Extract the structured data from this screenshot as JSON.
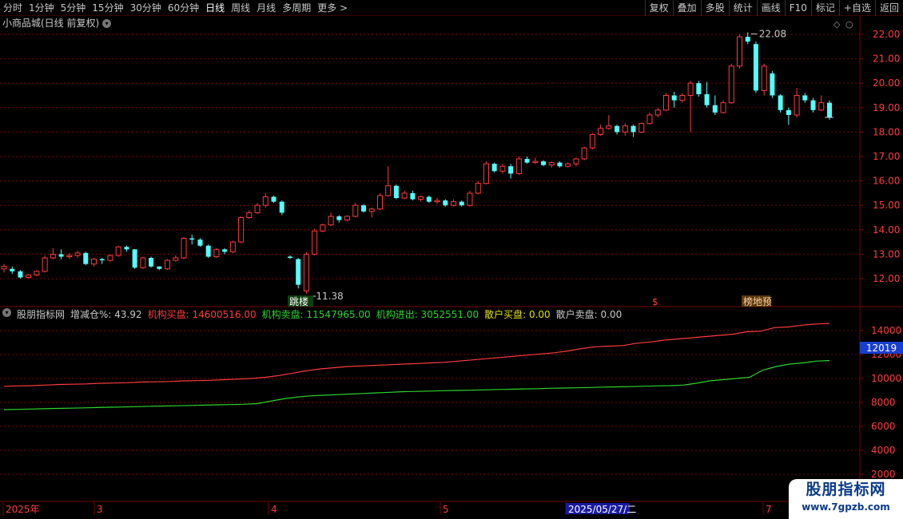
{
  "toolbar": {
    "periods": [
      "分时",
      "1分钟",
      "5分钟",
      "15分钟",
      "30分钟",
      "60分钟",
      "日线",
      "周线",
      "月线",
      "多周期",
      "更多"
    ],
    "active_period": "日线",
    "tools": [
      "复权",
      "叠加",
      "多股",
      "统计",
      "画线",
      "F10",
      "标记",
      "+自选",
      "返回"
    ]
  },
  "chart_title": "小商品城(日线 前复权)",
  "price_axis": [
    "22.00",
    "21.00",
    "20.00",
    "19.00",
    "18.00",
    "17.00",
    "16.00",
    "15.00",
    "14.00",
    "13.00",
    "12.00"
  ],
  "indicator_axis": [
    "14000",
    "12000",
    "10000",
    "8000",
    "6000",
    "4000",
    "2000"
  ],
  "indicator_current": "12019",
  "annotations": {
    "high": "22.08",
    "low": "11.38"
  },
  "signals": {
    "low_signal": "跳楼",
    "mid_signal": "$",
    "high_signal": "榜地预"
  },
  "indicator": {
    "name": "股朋指标网",
    "items": [
      {
        "label": "增减仓%: 43.92",
        "color": "#c8c8c8"
      },
      {
        "label": "机构买盘: 14600516.00",
        "color": "#ff3b3b"
      },
      {
        "label": "机构卖盘: 11547965.00",
        "color": "#2bd52b"
      },
      {
        "label": "机构进出: 3052551.00",
        "color": "#2bd52b"
      },
      {
        "label": "散户买盘: 0.00",
        "color": "#e0e000"
      },
      {
        "label": "散户卖盘: 0.00",
        "color": "#c8c8c8"
      }
    ]
  },
  "date_axis": [
    "2025年",
    "3",
    "4",
    "5",
    "2025/05/27/二",
    "7"
  ],
  "watermark": {
    "line1": "股朋指标网",
    "line2": "www.7gpzb.com"
  },
  "colors": {
    "up": "#ff3b3b",
    "down": "#54ffff",
    "grid": "#7a0000",
    "buy_line": "#ff3b3b",
    "sell_line": "#2bd52b"
  },
  "chart_data": {
    "type": "candlestick",
    "price_range": [
      11.0,
      22.4
    ],
    "candles": [
      [
        12.5,
        12.4,
        12.6,
        12.25,
        "u"
      ],
      [
        12.4,
        12.3,
        12.5,
        12.2,
        "d"
      ],
      [
        12.3,
        12.05,
        12.35,
        12.0,
        "d"
      ],
      [
        12.05,
        12.15,
        12.2,
        12.0,
        "u"
      ],
      [
        12.15,
        12.3,
        12.35,
        12.1,
        "u"
      ],
      [
        12.3,
        12.85,
        12.95,
        12.25,
        "u"
      ],
      [
        12.85,
        13.0,
        13.25,
        12.8,
        "u"
      ],
      [
        13.0,
        12.9,
        13.2,
        12.8,
        "d"
      ],
      [
        12.9,
        12.95,
        13.05,
        12.8,
        "u"
      ],
      [
        12.95,
        13.05,
        13.15,
        12.85,
        "u"
      ],
      [
        13.05,
        12.6,
        13.1,
        12.55,
        "d"
      ],
      [
        12.6,
        12.8,
        12.85,
        12.5,
        "u"
      ],
      [
        12.8,
        12.75,
        12.85,
        12.6,
        "d"
      ],
      [
        12.75,
        12.95,
        13.0,
        12.7,
        "u"
      ],
      [
        12.95,
        13.3,
        13.35,
        12.9,
        "u"
      ],
      [
        13.3,
        13.2,
        13.35,
        13.1,
        "d"
      ],
      [
        13.2,
        12.45,
        13.2,
        12.4,
        "d"
      ],
      [
        12.45,
        12.85,
        12.9,
        12.4,
        "u"
      ],
      [
        12.85,
        12.5,
        12.9,
        12.45,
        "d"
      ],
      [
        12.5,
        12.4,
        12.5,
        12.35,
        "d"
      ],
      [
        12.4,
        12.75,
        12.8,
        12.35,
        "u"
      ],
      [
        12.75,
        12.85,
        12.95,
        12.7,
        "u"
      ],
      [
        12.85,
        13.65,
        13.7,
        12.8,
        "u"
      ],
      [
        13.65,
        13.6,
        13.8,
        13.4,
        "d"
      ],
      [
        13.6,
        13.35,
        13.65,
        13.3,
        "d"
      ],
      [
        13.35,
        12.9,
        13.4,
        12.85,
        "d"
      ],
      [
        12.9,
        13.2,
        13.25,
        12.85,
        "u"
      ],
      [
        13.2,
        13.1,
        13.25,
        13.0,
        "d"
      ],
      [
        13.1,
        13.5,
        13.55,
        13.05,
        "u"
      ],
      [
        13.5,
        14.5,
        14.55,
        13.45,
        "u"
      ],
      [
        14.5,
        14.7,
        14.8,
        14.45,
        "u"
      ],
      [
        14.7,
        15.0,
        15.1,
        14.65,
        "u"
      ],
      [
        15.0,
        15.35,
        15.5,
        14.9,
        "u"
      ],
      [
        15.35,
        15.15,
        15.4,
        15.1,
        "d"
      ],
      [
        15.15,
        14.7,
        15.2,
        14.6,
        "d"
      ],
      [
        12.9,
        12.85,
        12.95,
        12.8,
        "d"
      ],
      [
        12.8,
        11.75,
        12.85,
        11.6,
        "d"
      ],
      [
        11.5,
        13.0,
        13.1,
        11.38,
        "u"
      ],
      [
        13.0,
        13.95,
        14.05,
        12.95,
        "u"
      ],
      [
        13.95,
        14.2,
        14.25,
        13.9,
        "u"
      ],
      [
        14.2,
        14.55,
        14.7,
        14.15,
        "u"
      ],
      [
        14.55,
        14.4,
        14.6,
        14.3,
        "d"
      ],
      [
        14.4,
        14.55,
        14.6,
        14.35,
        "u"
      ],
      [
        14.55,
        15.0,
        15.1,
        14.5,
        "u"
      ],
      [
        15.0,
        14.75,
        15.05,
        14.7,
        "d"
      ],
      [
        14.75,
        14.85,
        14.9,
        14.5,
        "u"
      ],
      [
        14.85,
        15.4,
        15.5,
        14.8,
        "u"
      ],
      [
        15.4,
        15.8,
        16.6,
        15.35,
        "u"
      ],
      [
        15.8,
        15.3,
        15.85,
        15.25,
        "d"
      ],
      [
        15.3,
        15.5,
        15.6,
        15.25,
        "u"
      ],
      [
        15.5,
        15.25,
        15.6,
        15.2,
        "d"
      ],
      [
        15.25,
        15.35,
        15.4,
        15.15,
        "u"
      ],
      [
        15.35,
        15.15,
        15.4,
        15.1,
        "d"
      ],
      [
        15.15,
        15.2,
        15.3,
        15.05,
        "u"
      ],
      [
        15.2,
        15.0,
        15.25,
        14.95,
        "d"
      ],
      [
        15.0,
        15.15,
        15.25,
        14.95,
        "u"
      ],
      [
        15.15,
        15.0,
        15.2,
        14.95,
        "d"
      ],
      [
        15.0,
        15.5,
        15.6,
        14.95,
        "u"
      ],
      [
        15.5,
        15.9,
        16.0,
        15.45,
        "u"
      ],
      [
        15.9,
        16.7,
        16.8,
        15.85,
        "u"
      ],
      [
        16.7,
        16.4,
        16.75,
        16.35,
        "d"
      ],
      [
        16.4,
        16.6,
        16.7,
        16.3,
        "u"
      ],
      [
        16.6,
        16.3,
        16.7,
        16.1,
        "d"
      ],
      [
        16.3,
        16.9,
        17.0,
        16.25,
        "u"
      ],
      [
        16.9,
        16.75,
        17.0,
        16.7,
        "d"
      ],
      [
        16.75,
        16.8,
        16.95,
        16.7,
        "u"
      ],
      [
        16.8,
        16.65,
        16.85,
        16.6,
        "d"
      ],
      [
        16.65,
        16.75,
        16.8,
        16.55,
        "u"
      ],
      [
        16.75,
        16.6,
        16.8,
        16.55,
        "d"
      ],
      [
        16.6,
        16.7,
        16.75,
        16.55,
        "u"
      ],
      [
        16.7,
        16.9,
        16.95,
        16.6,
        "u"
      ],
      [
        16.9,
        17.35,
        17.4,
        16.85,
        "u"
      ],
      [
        17.35,
        17.9,
        17.95,
        17.3,
        "u"
      ],
      [
        17.9,
        18.15,
        18.3,
        17.85,
        "u"
      ],
      [
        18.15,
        18.25,
        18.7,
        18.1,
        "u"
      ],
      [
        18.25,
        18.0,
        18.3,
        17.9,
        "d"
      ],
      [
        18.0,
        18.25,
        18.35,
        17.85,
        "u"
      ],
      [
        18.25,
        18.0,
        18.3,
        17.8,
        "d"
      ],
      [
        18.0,
        18.35,
        18.4,
        17.95,
        "u"
      ],
      [
        18.35,
        18.7,
        18.8,
        18.3,
        "u"
      ],
      [
        18.7,
        18.9,
        19.0,
        18.6,
        "u"
      ],
      [
        18.9,
        19.5,
        19.6,
        18.85,
        "u"
      ],
      [
        19.5,
        19.3,
        19.65,
        19.0,
        "d"
      ],
      [
        19.3,
        19.5,
        19.6,
        19.2,
        "u"
      ],
      [
        19.5,
        20.0,
        20.1,
        18.0,
        "u"
      ],
      [
        20.0,
        19.55,
        20.1,
        19.45,
        "d"
      ],
      [
        19.55,
        19.1,
        20.05,
        19.0,
        "d"
      ],
      [
        19.1,
        18.8,
        19.5,
        18.7,
        "d"
      ],
      [
        18.8,
        19.2,
        19.3,
        18.75,
        "u"
      ],
      [
        19.2,
        20.7,
        20.8,
        19.15,
        "u"
      ],
      [
        20.7,
        21.9,
        22.0,
        20.6,
        "u"
      ],
      [
        21.9,
        21.7,
        22.08,
        21.6,
        "d"
      ],
      [
        21.6,
        19.7,
        21.7,
        19.6,
        "d"
      ],
      [
        19.7,
        20.7,
        20.8,
        19.5,
        "u"
      ],
      [
        20.4,
        19.5,
        20.5,
        19.4,
        "d"
      ],
      [
        19.5,
        18.9,
        19.55,
        18.8,
        "d"
      ],
      [
        18.9,
        18.7,
        19.0,
        18.3,
        "d"
      ],
      [
        18.7,
        19.5,
        19.8,
        18.6,
        "u"
      ],
      [
        19.5,
        19.3,
        19.6,
        19.2,
        "d"
      ],
      [
        19.3,
        18.9,
        19.4,
        18.8,
        "d"
      ],
      [
        18.9,
        19.2,
        19.5,
        18.85,
        "u"
      ],
      [
        19.2,
        18.6,
        19.3,
        18.5,
        "d"
      ]
    ],
    "indicator_range": [
      2000,
      15000
    ],
    "buy_line": [
      9350,
      9380,
      9400,
      9450,
      9500,
      9520,
      9550,
      9600,
      9620,
      9650,
      9700,
      9720,
      9750,
      9800,
      9820,
      9850,
      9900,
      9950,
      10000,
      10100,
      10250,
      10450,
      10650,
      10800,
      10900,
      11000,
      11050,
      11100,
      11150,
      11200,
      11250,
      11300,
      11350,
      11450,
      11550,
      11650,
      11750,
      11850,
      11950,
      12050,
      12150,
      12300,
      12500,
      12650,
      12700,
      12750,
      12950,
      13050,
      13200,
      13300,
      13400,
      13500,
      13600,
      13700,
      13900,
      13950,
      14250,
      14300,
      14450,
      14550,
      14600
    ],
    "sell_line": [
      7400,
      7420,
      7450,
      7470,
      7500,
      7520,
      7550,
      7570,
      7600,
      7620,
      7650,
      7680,
      7700,
      7720,
      7750,
      7770,
      7800,
      7820,
      7850,
      7900,
      8100,
      8300,
      8450,
      8550,
      8600,
      8650,
      8700,
      8750,
      8800,
      8850,
      8900,
      8920,
      8950,
      8980,
      9000,
      9020,
      9050,
      9080,
      9100,
      9130,
      9150,
      9180,
      9200,
      9220,
      9250,
      9280,
      9300,
      9320,
      9350,
      9380,
      9400,
      9450,
      9600,
      9800,
      9900,
      10000,
      10100,
      10700,
      11000,
      11200,
      11300,
      11450,
      11500
    ]
  }
}
